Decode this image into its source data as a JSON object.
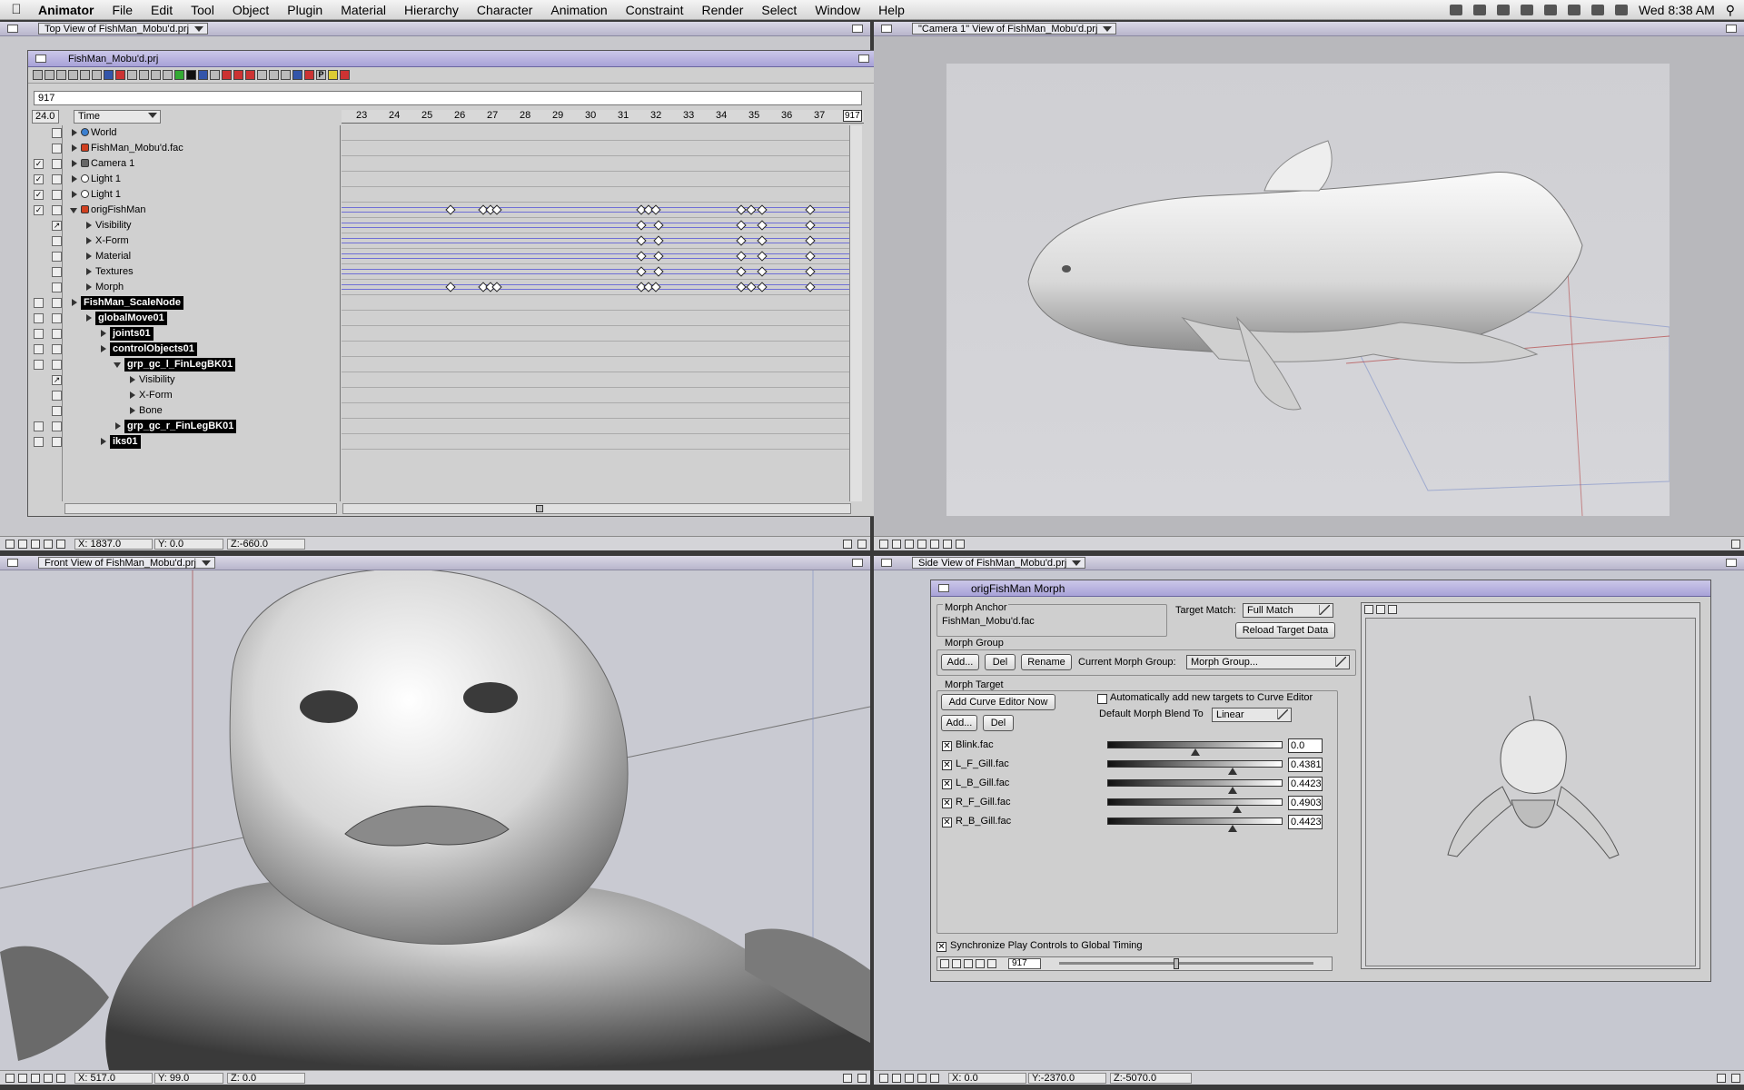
{
  "menubar": {
    "app": "Animator",
    "menus": [
      "File",
      "Edit",
      "Tool",
      "Object",
      "Plugin",
      "Material",
      "Hierarchy",
      "Character",
      "Animation",
      "Constraint",
      "Render",
      "Select",
      "Window",
      "Help"
    ],
    "clock": "Wed 8:38 AM"
  },
  "top_view": {
    "title": "Top View of FishMan_Mobu'd.prj",
    "x": "X: 1837.0",
    "y": "Y: 0.0",
    "z": "Z:-660.0"
  },
  "camera_view": {
    "title": "\"Camera 1\" View of FishMan_Mobu'd.prj"
  },
  "front_view": {
    "title": "Front View of FishMan_Mobu'd.prj",
    "x": "X: 517.0",
    "y": "Y: 99.0",
    "z": "Z: 0.0"
  },
  "side_view": {
    "title": "Side View of FishMan_Mobu'd.prj",
    "x": "X: 0.0",
    "y": "Y:-2370.0",
    "z": "Z:-5070.0"
  },
  "project": {
    "title": "FishMan_Mobu'd.prj",
    "frame": "917",
    "fps": "24.0",
    "time_label": "Time",
    "ruler": [
      "23",
      "24",
      "25",
      "26",
      "27",
      "28",
      "29",
      "30",
      "31",
      "32",
      "33",
      "34",
      "35",
      "36",
      "37"
    ],
    "ruler_end": "917",
    "tree": [
      {
        "label": "World",
        "depth": 0
      },
      {
        "label": "FishMan_Mobu'd.fac",
        "depth": 0
      },
      {
        "label": "Camera 1",
        "depth": 0
      },
      {
        "label": "Light 1",
        "depth": 0
      },
      {
        "label": "Light 1",
        "depth": 0
      },
      {
        "label": "origFishMan",
        "depth": 0
      },
      {
        "label": "Visibility",
        "depth": 1
      },
      {
        "label": "X-Form",
        "depth": 1
      },
      {
        "label": "Material",
        "depth": 1
      },
      {
        "label": "Textures",
        "depth": 1
      },
      {
        "label": "Morph",
        "depth": 1
      },
      {
        "label": "FishMan_ScaleNode",
        "depth": 0
      },
      {
        "label": "globalMove01",
        "depth": 1
      },
      {
        "label": "joints01",
        "depth": 2
      },
      {
        "label": "controlObjects01",
        "depth": 2
      },
      {
        "label": "grp_gc_l_FinLegBK01",
        "depth": 3
      },
      {
        "label": "Visibility",
        "depth": 4
      },
      {
        "label": "X-Form",
        "depth": 4
      },
      {
        "label": "Bone",
        "depth": 4
      },
      {
        "label": "grp_gc_r_FinLegBK01",
        "depth": 3
      },
      {
        "label": "iks01",
        "depth": 2
      }
    ]
  },
  "morph": {
    "title": "origFishMan Morph",
    "anchor_label": "Morph Anchor",
    "anchor_value": "FishMan_Mobu'd.fac",
    "target_match_label": "Target Match:",
    "target_match_value": "Full Match",
    "reload_button": "Reload Target Data",
    "group_label": "Morph Group",
    "add": "Add...",
    "del": "Del",
    "rename": "Rename",
    "current_group_label": "Current Morph Group:",
    "current_group_value": "Morph Group...",
    "target_label": "Morph Target",
    "add_curve_button": "Add Curve Editor Now",
    "auto_add_label": "Automatically add new targets to Curve Editor",
    "blend_label": "Default Morph Blend To",
    "blend_value": "Linear",
    "targets": [
      {
        "name": "Blink.fac",
        "value": "0.0",
        "level": 0.5
      },
      {
        "name": "L_F_Gill.fac",
        "value": "0.4381",
        "level": 0.72
      },
      {
        "name": "L_B_Gill.fac",
        "value": "0.4423",
        "level": 0.72
      },
      {
        "name": "R_F_Gill.fac",
        "value": "0.4903",
        "level": 0.75
      },
      {
        "name": "R_B_Gill.fac",
        "value": "0.4423",
        "level": 0.72
      }
    ],
    "sync_label": "Synchronize Play Controls to Global Timing",
    "play_frame": "917"
  },
  "colors": {
    "titlebar": "#b8b5cc",
    "timeline_track": "#6f6fd6",
    "viewport_bg": "#c8c8cc"
  }
}
